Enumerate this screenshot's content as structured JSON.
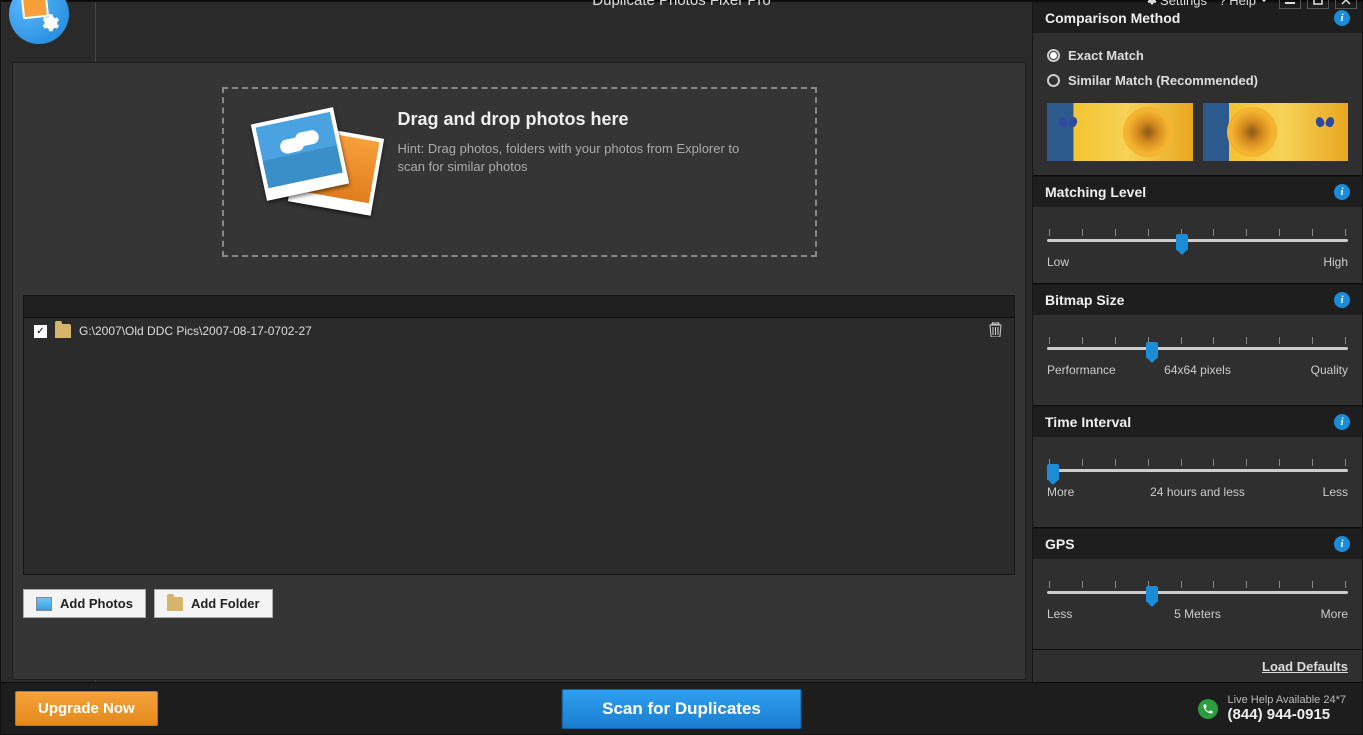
{
  "titlebar": {
    "title": "Duplicate Photos Fixer Pro",
    "settings": "Settings",
    "help": "Help"
  },
  "dropzone": {
    "heading": "Drag and drop photos here",
    "hint": "Hint: Drag photos, folders with your photos from Explorer to scan for similar photos"
  },
  "files": {
    "path": "G:\\2007\\Old DDC Pics\\2007-08-17-0702-27"
  },
  "buttons": {
    "add_photos": "Add Photos",
    "add_folder": "Add Folder"
  },
  "sidebar": {
    "comparison": {
      "title": "Comparison Method",
      "exact": "Exact Match",
      "similar": "Similar Match (Recommended)"
    },
    "matching": {
      "title": "Matching Level",
      "low": "Low",
      "high": "High"
    },
    "bitmap": {
      "title": "Bitmap Size",
      "perf": "Performance",
      "qual": "Quality",
      "value": "64x64 pixels"
    },
    "time": {
      "title": "Time Interval",
      "more": "More",
      "less": "Less",
      "value": "24 hours and less"
    },
    "gps": {
      "title": "GPS",
      "less": "Less",
      "more": "More",
      "value": "5 Meters"
    },
    "load_defaults": "Load Defaults"
  },
  "footer": {
    "upgrade": "Upgrade Now",
    "scan": "Scan for Duplicates",
    "help_line": "Live Help Available 24*7",
    "phone": "(844) 944-0915"
  }
}
